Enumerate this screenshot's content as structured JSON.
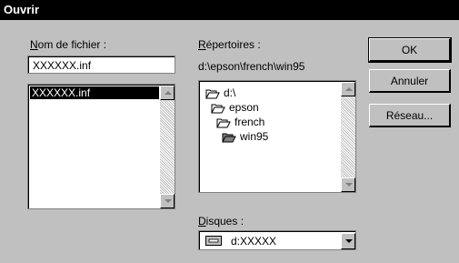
{
  "window": {
    "title": "Ouvrir"
  },
  "filename": {
    "label_accel": "N",
    "label_rest": "om de fichier :",
    "value": "XXXXXX.inf",
    "list_items": [
      "XXXXXX.inf"
    ]
  },
  "directories": {
    "label_accel": "R",
    "label_rest": "épertoires :",
    "current_path": "d:\\epson\\french\\win95",
    "tree": [
      "d:\\",
      "epson",
      "french",
      "win95"
    ]
  },
  "drives": {
    "label_accel": "D",
    "label_rest": "isques :",
    "selected": "d:XXXXX"
  },
  "buttons": {
    "ok": "OK",
    "cancel": "Annuler",
    "network": "Réseau..."
  }
}
